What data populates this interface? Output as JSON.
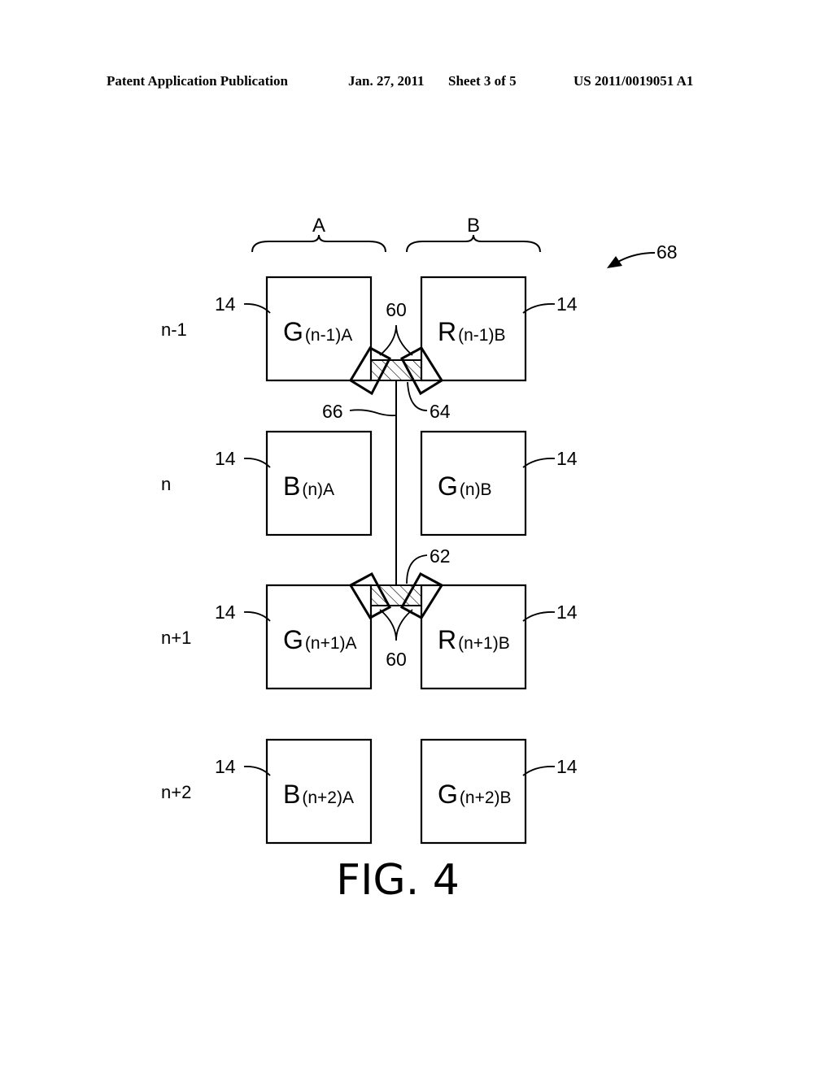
{
  "header": {
    "publication": "Patent Application Publication",
    "date": "Jan. 27, 2011",
    "sheet": "Sheet 3 of 5",
    "number": "US 2011/0019051 A1"
  },
  "figure": {
    "caption": "FIG. 4",
    "overall_ref": "68",
    "columns": [
      {
        "label": "A"
      },
      {
        "label": "B"
      }
    ],
    "rows": [
      {
        "label": "n-1",
        "cells": [
          {
            "letter": "G",
            "sub": "(n-1)A",
            "ref": "14"
          },
          {
            "letter": "R",
            "sub": "(n-1)B",
            "ref": "14"
          }
        ]
      },
      {
        "label": "n",
        "cells": [
          {
            "letter": "B",
            "sub": "(n)A",
            "ref": "14"
          },
          {
            "letter": "G",
            "sub": "(n)B",
            "ref": "14"
          }
        ]
      },
      {
        "label": "n+1",
        "cells": [
          {
            "letter": "G",
            "sub": "(n+1)A",
            "ref": "14"
          },
          {
            "letter": "R",
            "sub": "(n+1)B",
            "ref": "14"
          }
        ]
      },
      {
        "label": "n+2",
        "cells": [
          {
            "letter": "B",
            "sub": "(n+2)A",
            "ref": "14"
          },
          {
            "letter": "G",
            "sub": "(n+2)B",
            "ref": "14"
          }
        ]
      }
    ],
    "refs": {
      "contacts_top": "60",
      "contacts_bottom": "60",
      "pad_top": "64",
      "pad_bottom": "62",
      "line": "66"
    }
  }
}
